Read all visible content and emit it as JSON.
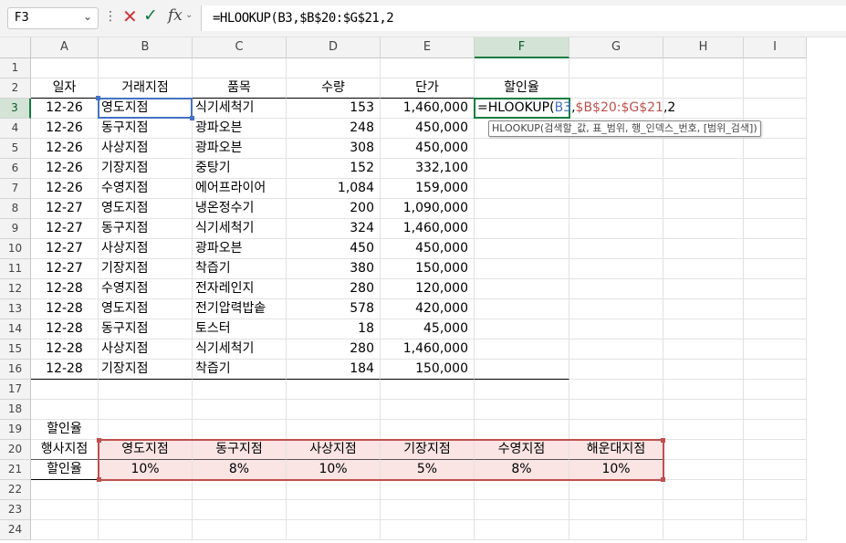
{
  "formula_bar": {
    "name_box": "F3",
    "cancel_icon": "close-icon",
    "enter_icon": "check-icon",
    "fx_label": "fx",
    "formula": "=HLOOKUP(B3,$B$20:$G$21,2"
  },
  "columns": [
    "A",
    "B",
    "C",
    "D",
    "E",
    "F",
    "G",
    "H",
    "I"
  ],
  "selected_column": "F",
  "selected_row": "3",
  "rows": [
    "1",
    "2",
    "3",
    "4",
    "5",
    "6",
    "7",
    "8",
    "9",
    "10",
    "11",
    "12",
    "13",
    "14",
    "15",
    "16",
    "17",
    "18",
    "19",
    "20",
    "21",
    "22",
    "23",
    "24"
  ],
  "sales_table": {
    "headers": [
      "일자",
      "거래지점",
      "품목",
      "수량",
      "단가",
      "할인율"
    ],
    "records": [
      [
        "12-26",
        "영도지점",
        "식기세척기",
        "153",
        "1,460,000"
      ],
      [
        "12-26",
        "동구지점",
        "광파오븐",
        "248",
        "450,000"
      ],
      [
        "12-26",
        "사상지점",
        "광파오븐",
        "308",
        "450,000"
      ],
      [
        "12-26",
        "기장지점",
        "중탕기",
        "152",
        "332,100"
      ],
      [
        "12-26",
        "수영지점",
        "에어프라이어",
        "1,084",
        "159,000"
      ],
      [
        "12-27",
        "영도지점",
        "냉온정수기",
        "200",
        "1,090,000"
      ],
      [
        "12-27",
        "동구지점",
        "식기세척기",
        "324",
        "1,460,000"
      ],
      [
        "12-27",
        "사상지점",
        "광파오븐",
        "450",
        "450,000"
      ],
      [
        "12-27",
        "기장지점",
        "착즙기",
        "380",
        "150,000"
      ],
      [
        "12-28",
        "수영지점",
        "전자레인지",
        "280",
        "120,000"
      ],
      [
        "12-28",
        "영도지점",
        "전기압력밥솥",
        "578",
        "420,000"
      ],
      [
        "12-28",
        "동구지점",
        "토스터",
        "18",
        "45,000"
      ],
      [
        "12-28",
        "사상지점",
        "식기세척기",
        "280",
        "1,460,000"
      ],
      [
        "12-28",
        "기장지점",
        "착즙기",
        "184",
        "150,000"
      ]
    ]
  },
  "editing_cell": {
    "prefix": "=HLOOKUP(",
    "ref1": "B3",
    "sep1": ",",
    "ref2": "$B$20:$G$21",
    "rest": ",2"
  },
  "tooltip": "HLOOKUP(검색할_값, 표_범위, 행_인덱스_번호, [범위_검색])",
  "discount_table": {
    "title": "할인율",
    "row_label_1": "행사지점",
    "row_label_2": "할인율",
    "branches": [
      "영도지점",
      "동구지점",
      "사상지점",
      "기장지점",
      "수영지점",
      "해운대지점"
    ],
    "rates": [
      "10%",
      "8%",
      "10%",
      "5%",
      "8%",
      "10%"
    ]
  },
  "colors": {
    "excel_green": "#107c41",
    "ref_blue": "#4472c4",
    "ref_red": "#c0504d",
    "range_fill": "#fbe4e4"
  }
}
